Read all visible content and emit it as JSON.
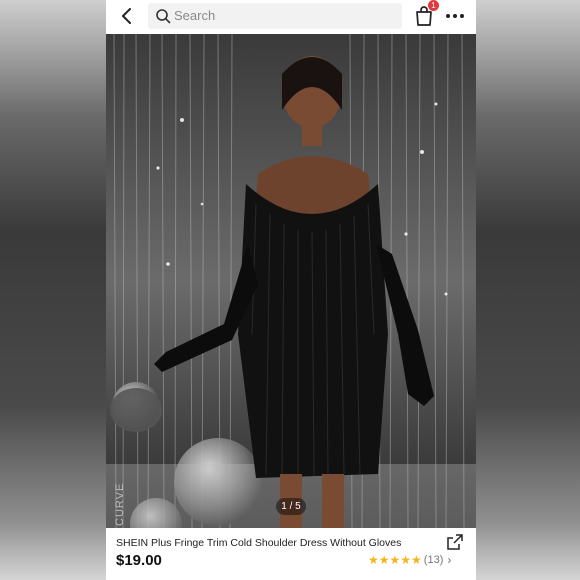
{
  "header": {
    "search_placeholder": "Search",
    "cart_count": "1"
  },
  "gallery": {
    "pager": "1 / 5",
    "watermark": "CURVE"
  },
  "product": {
    "title": "SHEIN Plus Fringe Trim Cold Shoulder Dress Without Gloves",
    "price": "$19.00",
    "stars": "★★★★★",
    "review_count": "(13)"
  },
  "icons": {
    "back": "chevron-left-icon",
    "search": "search-icon",
    "cart": "shopping-bag-icon",
    "more": "more-dots-icon",
    "share": "share-icon",
    "review_chevron": "chevron-right-icon"
  },
  "colors": {
    "badge": "#e4393c",
    "stars": "#f6b41f"
  }
}
